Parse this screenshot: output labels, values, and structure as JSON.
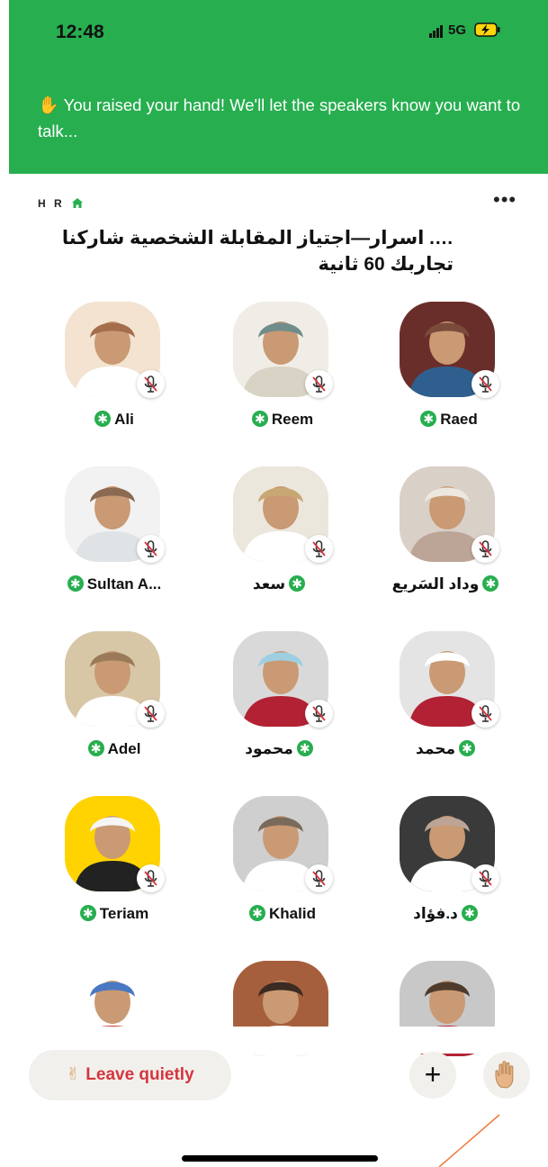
{
  "status": {
    "time": "12:48",
    "network": "5G"
  },
  "banner": {
    "emoji": "✋",
    "text": "You raised your hand! We'll let the speakers know you want to talk..."
  },
  "room": {
    "club": "H R",
    "title": "…. اسرار—اجتياز المقابلة الشخصية شاركنا تجاربك 60 ثانية"
  },
  "speakers": [
    {
      "name": "Ali",
      "muted": true,
      "moderator": true
    },
    {
      "name": "Reem",
      "muted": true,
      "moderator": true
    },
    {
      "name": "Raed",
      "muted": true,
      "moderator": true
    },
    {
      "name": "Sultan A...",
      "muted": true,
      "moderator": true
    },
    {
      "name": "سعد",
      "muted": true,
      "moderator": true
    },
    {
      "name": "وداد السَريع",
      "muted": true,
      "moderator": true
    },
    {
      "name": "Adel",
      "muted": true,
      "moderator": true
    },
    {
      "name": "محمود",
      "muted": true,
      "moderator": true
    },
    {
      "name": "محمد",
      "muted": true,
      "moderator": true
    },
    {
      "name": "Teriam",
      "muted": true,
      "moderator": true
    },
    {
      "name": "Khalid",
      "muted": true,
      "moderator": true
    },
    {
      "name": "د.فؤاد",
      "muted": true,
      "moderator": true
    },
    {
      "name": "",
      "muted": false,
      "moderator": false
    },
    {
      "name": "",
      "muted": false,
      "moderator": false
    },
    {
      "name": "",
      "muted": false,
      "moderator": false
    }
  ],
  "actions": {
    "leave_emoji": "✌",
    "leave_label": "Leave quietly",
    "plus": "+",
    "hand_emoji": "✋"
  },
  "colors": {
    "accent": "#27ae4f",
    "leave_text": "#d4363f",
    "button_bg": "#f2f0ec"
  }
}
